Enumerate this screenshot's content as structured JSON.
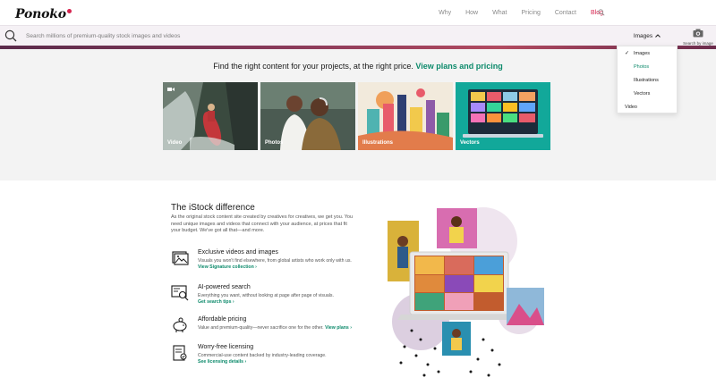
{
  "header": {
    "logo": "Ponoko",
    "nav": [
      "Why",
      "How",
      "What",
      "Pricing",
      "Contact",
      "Blog"
    ]
  },
  "search": {
    "placeholder": "Search millions of premium-quality stock images and videos",
    "type_selected": "Images",
    "camera_label": "Search by image"
  },
  "dropdown": {
    "items": [
      "Images",
      "Photos",
      "Illustrations",
      "Vectors",
      "Video"
    ],
    "checked": "Images",
    "highlighted": "Photos"
  },
  "hero": {
    "title": "Find the right content for your projects, at the right price.",
    "link": "View plans and pricing",
    "tiles": [
      "Video",
      "Photos",
      "Illustrations",
      "Vectors"
    ]
  },
  "difference": {
    "title": "The iStock difference",
    "text": "As the original stock content site created by creatives for creatives, we get you. You need unique images and videos that connect with your audience, at prices that fit your budget. We've got all that—and more.",
    "features": [
      {
        "title": "Exclusive videos and images",
        "desc": "Visuals you won't find elsewhere, from global artists who work only with us.",
        "link": "View Signature collection ›"
      },
      {
        "title": "AI-powered search",
        "desc": "Everything you want, without looking at page after page of visuals.",
        "link": "Get search tips ›"
      },
      {
        "title": "Affordable pricing",
        "desc": "Value and premium-quality—never sacrifice one for the other.",
        "link": "View plans ›"
      },
      {
        "title": "Worry-free licensing",
        "desc": "Commercial-use content backed by industry-leading coverage.",
        "link": "See licensing details ›"
      }
    ]
  },
  "colors": {
    "accent": "#0c8a6b",
    "brand": "#d6244f",
    "bar": "#8a3a5a"
  }
}
